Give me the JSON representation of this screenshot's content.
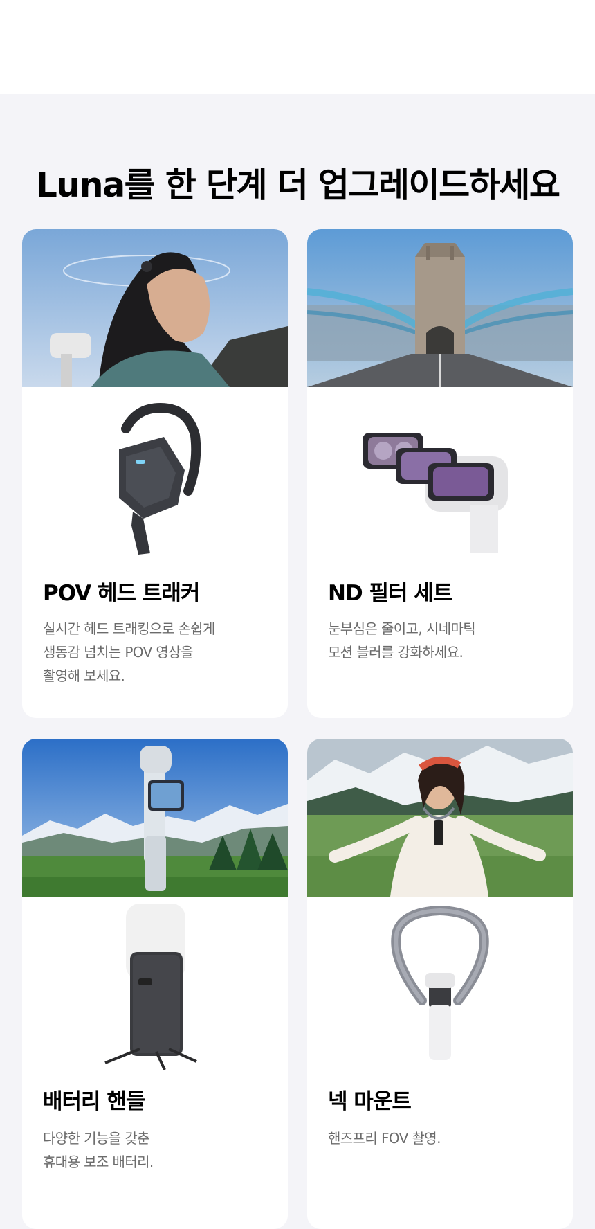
{
  "page": {
    "heading": "Luna를 한 단계 더 업그레이드하세요"
  },
  "cards": [
    {
      "title": "POV 헤드 트래커",
      "description": "실시간 헤드 트래킹으로 손쉽게\n생동감 넘치는 POV 영상을\n촬영해 보세요."
    },
    {
      "title": "ND 필터 세트",
      "description": "눈부심은 줄이고, 시네마틱\n모션 블러를 강화하세요."
    },
    {
      "title": "배터리 핸들",
      "description": "다양한 기능을 갖춘\n휴대용 보조 배터리."
    },
    {
      "title": "넥 마운트",
      "description": "핸즈프리 FOV 촬영."
    }
  ],
  "colors": {
    "section_background": "#f4f4f8",
    "card_background": "#ffffff",
    "heading_text": "#000000",
    "description_text": "#6b6b6b"
  }
}
